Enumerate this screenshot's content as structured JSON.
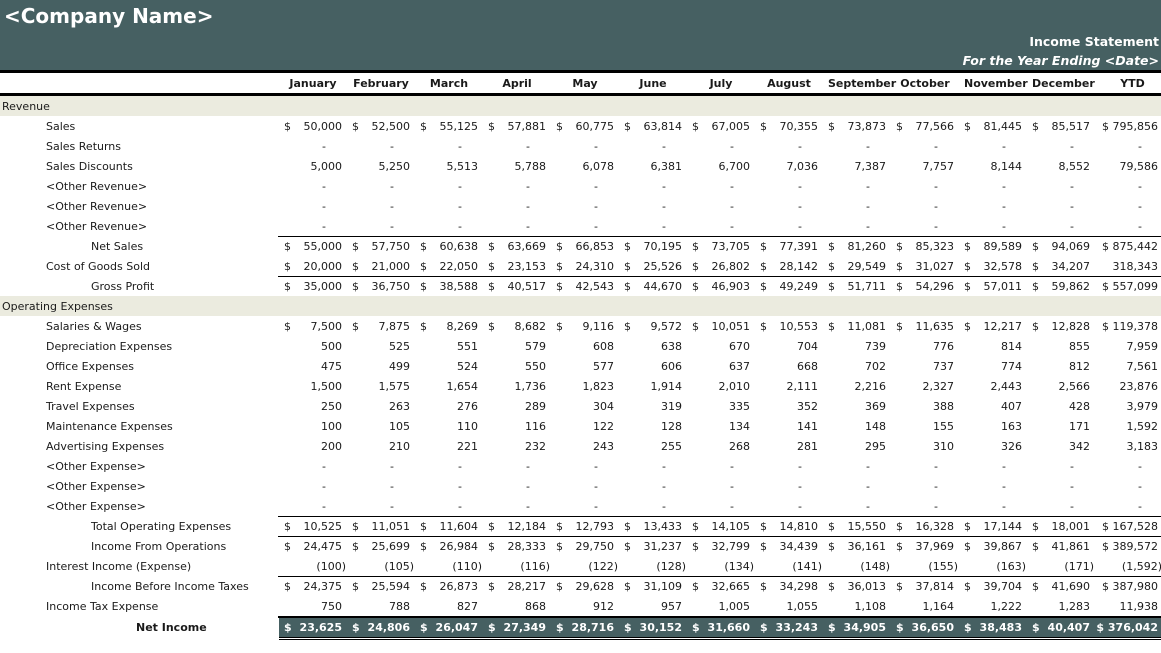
{
  "header": {
    "company_name": "<Company Name>",
    "statement_title": "Income Statement",
    "statement_subtitle": "For the Year Ending <Date>",
    "accent_color": "#466062",
    "section_color": "#ebebdf"
  },
  "columns": [
    "January",
    "February",
    "March",
    "April",
    "May",
    "June",
    "July",
    "August",
    "September",
    "October",
    "November",
    "December",
    "YTD"
  ],
  "rows": [
    {
      "label": "Revenue",
      "type": "section"
    },
    {
      "label": "Sales",
      "type": "line",
      "dollar": true,
      "values": [
        "50,000",
        "52,500",
        "55,125",
        "57,881",
        "60,775",
        "63,814",
        "67,005",
        "70,355",
        "73,873",
        "77,566",
        "81,445",
        "85,517",
        "$ 795,856"
      ]
    },
    {
      "label": "Sales Returns",
      "type": "line",
      "values": [
        "-",
        "-",
        "-",
        "-",
        "-",
        "-",
        "-",
        "-",
        "-",
        "-",
        "-",
        "-",
        "-"
      ]
    },
    {
      "label": "Sales Discounts",
      "type": "line",
      "values": [
        "5,000",
        "5,250",
        "5,513",
        "5,788",
        "6,078",
        "6,381",
        "6,700",
        "7,036",
        "7,387",
        "7,757",
        "8,144",
        "8,552",
        "79,586"
      ]
    },
    {
      "label": "<Other Revenue>",
      "type": "line",
      "values": [
        "-",
        "-",
        "-",
        "-",
        "-",
        "-",
        "-",
        "-",
        "-",
        "-",
        "-",
        "-",
        "-"
      ]
    },
    {
      "label": "<Other Revenue>",
      "type": "line",
      "values": [
        "-",
        "-",
        "-",
        "-",
        "-",
        "-",
        "-",
        "-",
        "-",
        "-",
        "-",
        "-",
        "-"
      ]
    },
    {
      "label": "<Other Revenue>",
      "type": "line",
      "values": [
        "-",
        "-",
        "-",
        "-",
        "-",
        "-",
        "-",
        "-",
        "-",
        "-",
        "-",
        "-",
        "-"
      ]
    },
    {
      "label": "Net Sales",
      "type": "subtotal",
      "dollar": true,
      "topline": true,
      "values": [
        "55,000",
        "57,750",
        "60,638",
        "63,669",
        "66,853",
        "70,195",
        "73,705",
        "77,391",
        "81,260",
        "85,323",
        "89,589",
        "94,069",
        "$ 875,442"
      ]
    },
    {
      "label": "Cost of Goods Sold",
      "type": "line",
      "dollar": true,
      "values": [
        "20,000",
        "21,000",
        "22,050",
        "23,153",
        "24,310",
        "25,526",
        "26,802",
        "28,142",
        "29,549",
        "31,027",
        "32,578",
        "34,207",
        "318,343"
      ]
    },
    {
      "label": "Gross Profit",
      "type": "subtotal",
      "dollar": true,
      "topline": true,
      "values": [
        "35,000",
        "36,750",
        "38,588",
        "40,517",
        "42,543",
        "44,670",
        "46,903",
        "49,249",
        "51,711",
        "54,296",
        "57,011",
        "59,862",
        "$ 557,099"
      ]
    },
    {
      "label": "Operating Expenses",
      "type": "section"
    },
    {
      "label": "Salaries & Wages",
      "type": "line",
      "dollar": true,
      "values": [
        "7,500",
        "7,875",
        "8,269",
        "8,682",
        "9,116",
        "9,572",
        "10,051",
        "10,553",
        "11,081",
        "11,635",
        "12,217",
        "12,828",
        "$ 119,378"
      ]
    },
    {
      "label": "Depreciation Expenses",
      "type": "line",
      "values": [
        "500",
        "525",
        "551",
        "579",
        "608",
        "638",
        "670",
        "704",
        "739",
        "776",
        "814",
        "855",
        "7,959"
      ]
    },
    {
      "label": "Office Expenses",
      "type": "line",
      "values": [
        "475",
        "499",
        "524",
        "550",
        "577",
        "606",
        "637",
        "668",
        "702",
        "737",
        "774",
        "812",
        "7,561"
      ]
    },
    {
      "label": "Rent Expense",
      "type": "line",
      "values": [
        "1,500",
        "1,575",
        "1,654",
        "1,736",
        "1,823",
        "1,914",
        "2,010",
        "2,111",
        "2,216",
        "2,327",
        "2,443",
        "2,566",
        "23,876"
      ]
    },
    {
      "label": "Travel Expenses",
      "type": "line",
      "values": [
        "250",
        "263",
        "276",
        "289",
        "304",
        "319",
        "335",
        "352",
        "369",
        "388",
        "407",
        "428",
        "3,979"
      ]
    },
    {
      "label": "Maintenance Expenses",
      "type": "line",
      "values": [
        "100",
        "105",
        "110",
        "116",
        "122",
        "128",
        "134",
        "141",
        "148",
        "155",
        "163",
        "171",
        "1,592"
      ]
    },
    {
      "label": "Advertising Expenses",
      "type": "line",
      "values": [
        "200",
        "210",
        "221",
        "232",
        "243",
        "255",
        "268",
        "281",
        "295",
        "310",
        "326",
        "342",
        "3,183"
      ]
    },
    {
      "label": "<Other Expense>",
      "type": "line",
      "values": [
        "-",
        "-",
        "-",
        "-",
        "-",
        "-",
        "-",
        "-",
        "-",
        "-",
        "-",
        "-",
        "-"
      ]
    },
    {
      "label": "<Other Expense>",
      "type": "line",
      "values": [
        "-",
        "-",
        "-",
        "-",
        "-",
        "-",
        "-",
        "-",
        "-",
        "-",
        "-",
        "-",
        "-"
      ]
    },
    {
      "label": "<Other Expense>",
      "type": "line",
      "values": [
        "-",
        "-",
        "-",
        "-",
        "-",
        "-",
        "-",
        "-",
        "-",
        "-",
        "-",
        "-",
        "-"
      ]
    },
    {
      "label": "Total Operating Expenses",
      "type": "subtotal",
      "dollar": true,
      "topline": true,
      "values": [
        "10,525",
        "11,051",
        "11,604",
        "12,184",
        "12,793",
        "13,433",
        "14,105",
        "14,810",
        "15,550",
        "16,328",
        "17,144",
        "18,001",
        "$ 167,528"
      ]
    },
    {
      "label": "Income From Operations",
      "type": "subtotal",
      "dollar": true,
      "topline": true,
      "values": [
        "24,475",
        "25,699",
        "26,984",
        "28,333",
        "29,750",
        "31,237",
        "32,799",
        "34,439",
        "36,161",
        "37,969",
        "39,867",
        "41,861",
        "$ 389,572"
      ]
    },
    {
      "label": "Interest Income (Expense)",
      "type": "line",
      "values": [
        "(100)",
        "(105)",
        "(110)",
        "(116)",
        "(122)",
        "(128)",
        "(134)",
        "(141)",
        "(148)",
        "(155)",
        "(163)",
        "(171)",
        "(1,592)"
      ]
    },
    {
      "label": "Income Before Income Taxes",
      "type": "subtotal",
      "dollar": true,
      "topline": true,
      "values": [
        "24,375",
        "25,594",
        "26,873",
        "28,217",
        "29,628",
        "31,109",
        "32,665",
        "34,298",
        "36,013",
        "37,814",
        "39,704",
        "41,690",
        "$ 387,980"
      ]
    },
    {
      "label": "Income Tax Expense",
      "type": "line",
      "values": [
        "750",
        "788",
        "827",
        "868",
        "912",
        "957",
        "1,005",
        "1,055",
        "1,108",
        "1,164",
        "1,222",
        "1,283",
        "11,938"
      ]
    },
    {
      "label": "Net Income",
      "type": "total",
      "dollar": true,
      "values": [
        "23,625",
        "24,806",
        "26,047",
        "27,349",
        "28,716",
        "30,152",
        "31,660",
        "33,243",
        "34,905",
        "36,650",
        "38,483",
        "40,407",
        "$ 376,042"
      ]
    }
  ]
}
